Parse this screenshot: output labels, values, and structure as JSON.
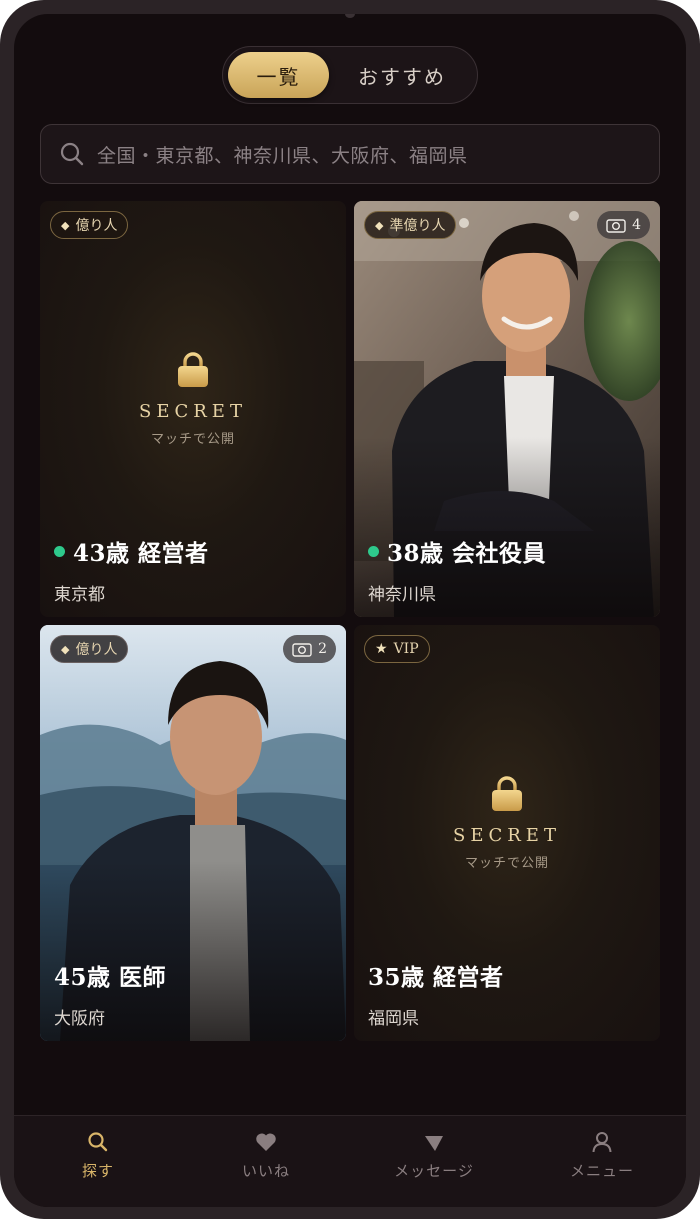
{
  "segment": {
    "active_label": "一覧",
    "inactive_label": "おすすめ"
  },
  "search": {
    "placeholder": "全国・東京都、神奈川県、大阪府、福岡県",
    "icon": "search-icon"
  },
  "cards": [
    {
      "badge": "億り人",
      "badge_icon": "diamond",
      "locked": true,
      "secret": "SECRET",
      "reveal_text": "マッチで公開",
      "online": true,
      "title": "43歳 経営者",
      "location": "東京都"
    },
    {
      "badge": "準億り人",
      "badge_icon": "diamond",
      "locked": false,
      "photo_count": "4",
      "online": true,
      "title": "38歳 会社役員",
      "location": "神奈川県"
    },
    {
      "badge": "億り人",
      "badge_icon": "diamond",
      "locked": false,
      "photo_count": "2",
      "online": false,
      "title": "45歳 医師",
      "location": "大阪府"
    },
    {
      "badge": "VIP",
      "badge_icon": "star",
      "locked": true,
      "secret": "SECRET",
      "reveal_text": "マッチで公開",
      "online": false,
      "title": "35歳 経営者",
      "location": "福岡県"
    }
  ],
  "tabbar": {
    "items": [
      {
        "label": "探す",
        "icon": "search-icon",
        "active": true
      },
      {
        "label": "いいね",
        "icon": "heart-icon",
        "active": false
      },
      {
        "label": "メッセージ",
        "icon": "send-icon",
        "active": false
      },
      {
        "label": "メニュー",
        "icon": "user-icon",
        "active": false
      }
    ]
  },
  "colors": {
    "gold_accent": "#d9b569",
    "online_green": "#2ec98c",
    "background": "#130c0e"
  }
}
